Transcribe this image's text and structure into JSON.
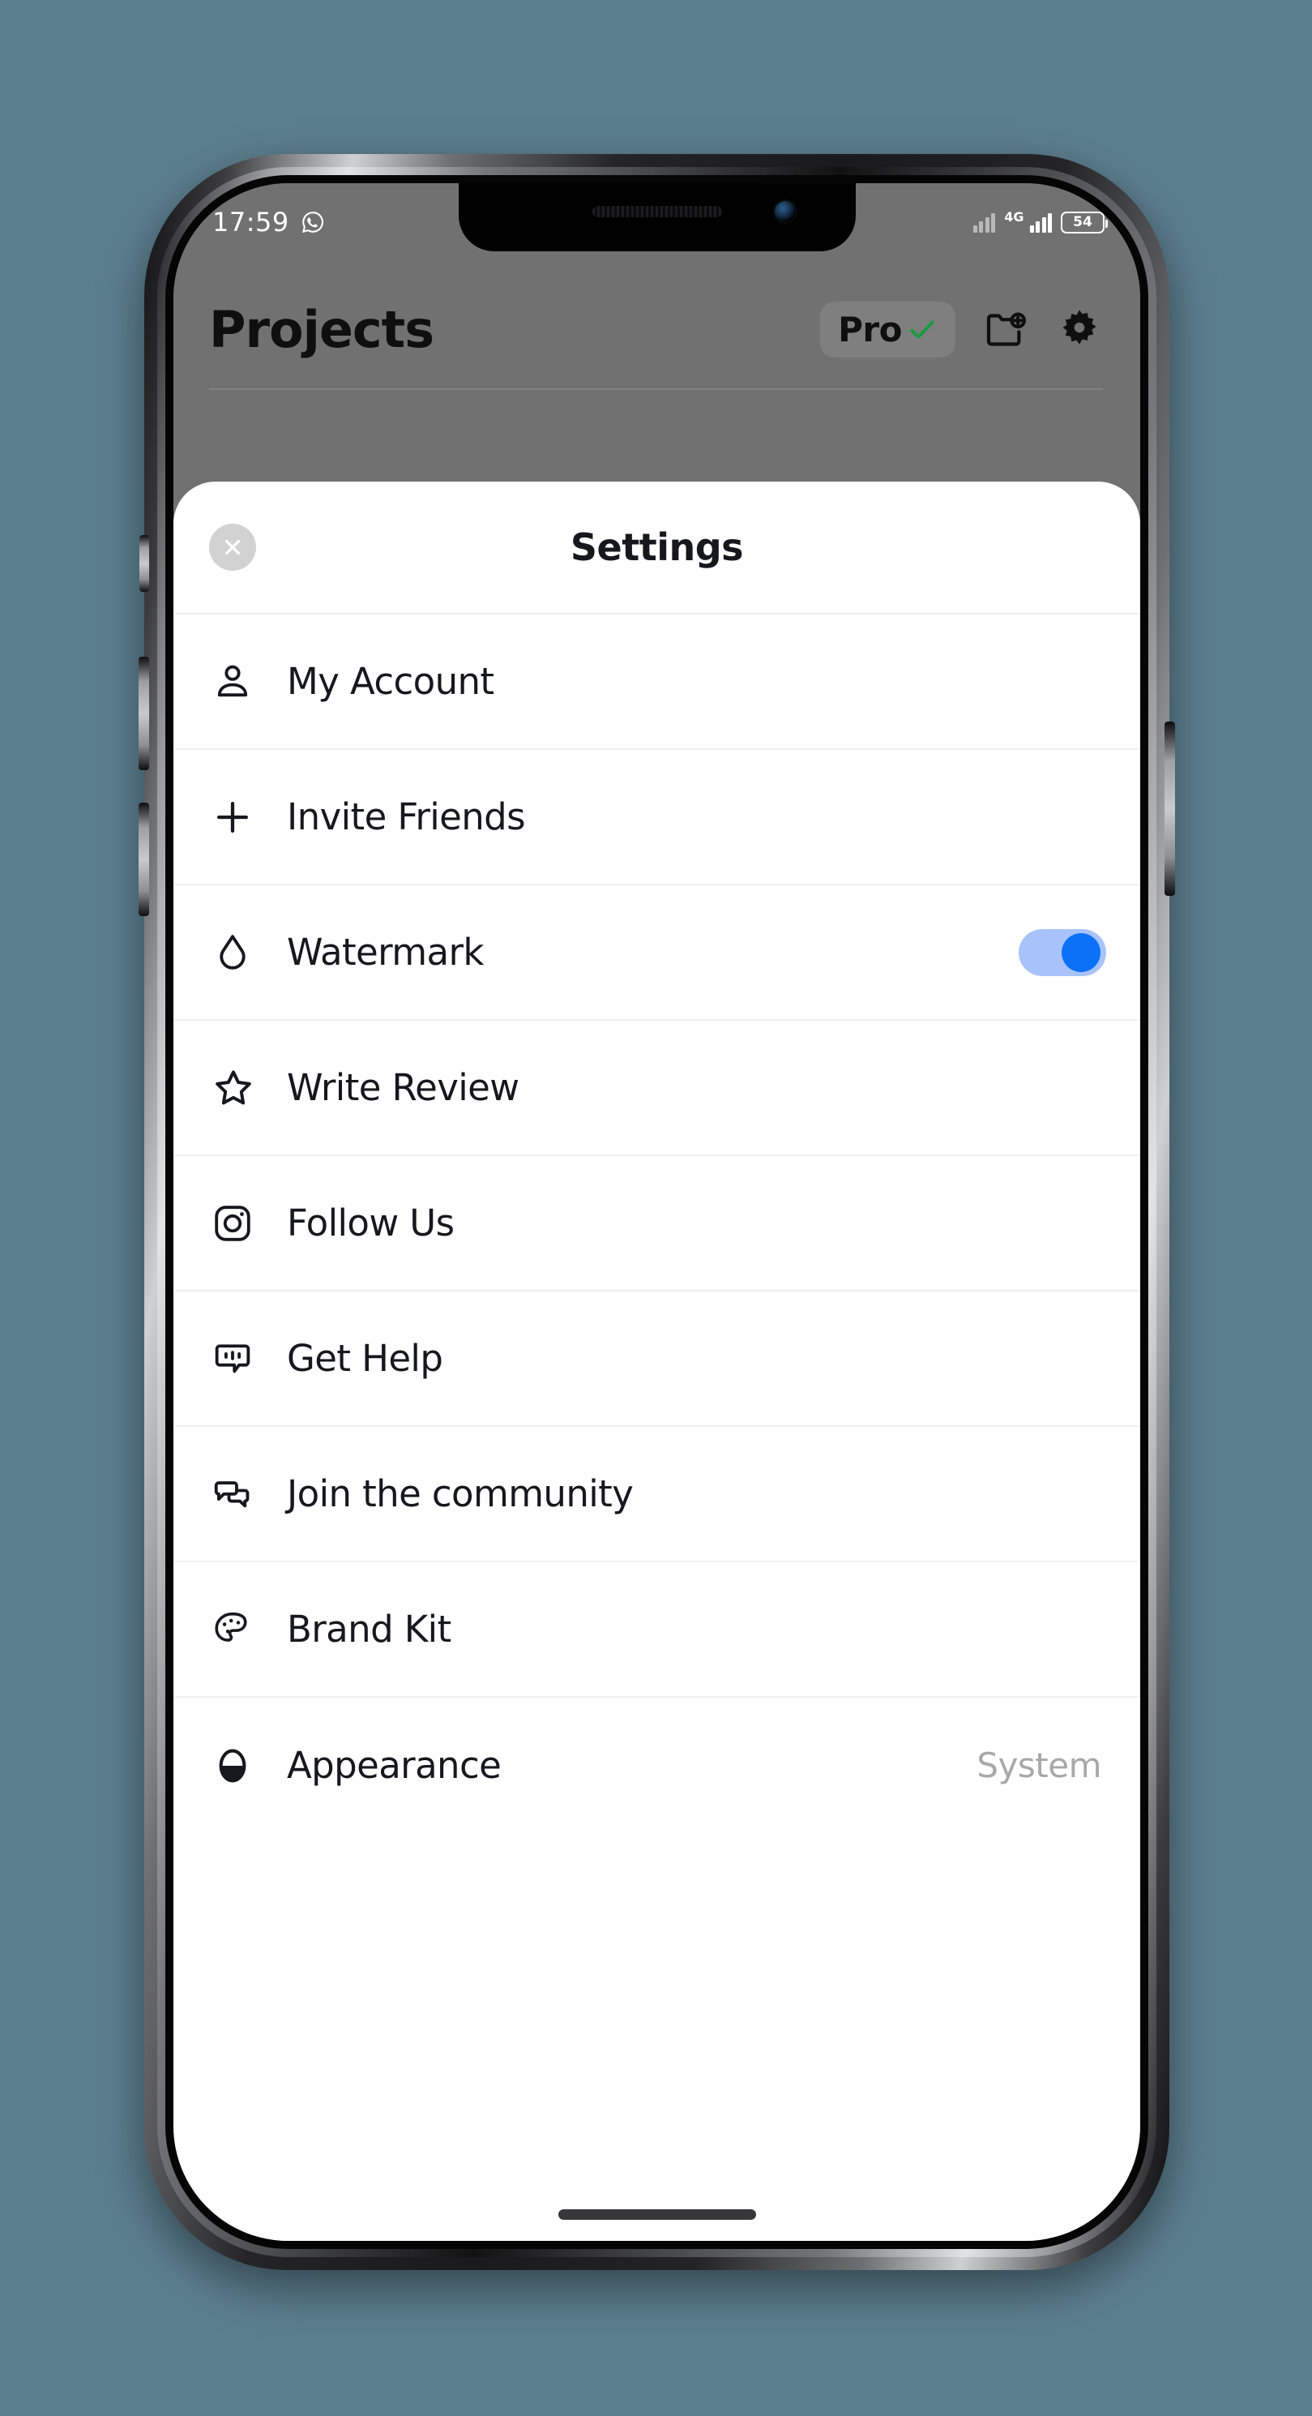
{
  "status_bar": {
    "time": "17:59",
    "messenger_icon": "whatsapp-icon",
    "network_type": "4G",
    "battery_percent": "54"
  },
  "app_header": {
    "title": "Projects",
    "pro_badge_label": "Pro",
    "pro_badge_check": "check-icon",
    "new_folder_icon": "new-folder-icon",
    "settings_icon": "gear-icon"
  },
  "sheet": {
    "title": "Settings",
    "close_icon": "close-icon",
    "items": [
      {
        "icon": "person-icon",
        "label": "My Account",
        "value": "",
        "control": "none"
      },
      {
        "icon": "plus-icon",
        "label": "Invite Friends",
        "value": "",
        "control": "none"
      },
      {
        "icon": "droplet-icon",
        "label": "Watermark",
        "value": "",
        "control": "toggle",
        "toggle_on": true
      },
      {
        "icon": "star-icon",
        "label": "Write Review",
        "value": "",
        "control": "none"
      },
      {
        "icon": "instagram-icon",
        "label": "Follow Us",
        "value": "",
        "control": "none"
      },
      {
        "icon": "chat-help-icon",
        "label": "Get Help",
        "value": "",
        "control": "none"
      },
      {
        "icon": "chat-bubbles-icon",
        "label": "Join the community",
        "value": "",
        "control": "none"
      },
      {
        "icon": "palette-icon",
        "label": "Brand Kit",
        "value": "",
        "control": "none"
      },
      {
        "icon": "contrast-icon",
        "label": "Appearance",
        "value": "System",
        "control": "value"
      }
    ]
  },
  "colors": {
    "wallpaper": "#5c7f8f",
    "sheet_bg": "#ffffff",
    "text": "#15181c",
    "muted_text": "#a8a8a8",
    "toggle_track": "#a8c3fb",
    "toggle_knob": "#0b72f7",
    "badge_check": "#1d9a43",
    "divider": "#f1f1f1"
  }
}
